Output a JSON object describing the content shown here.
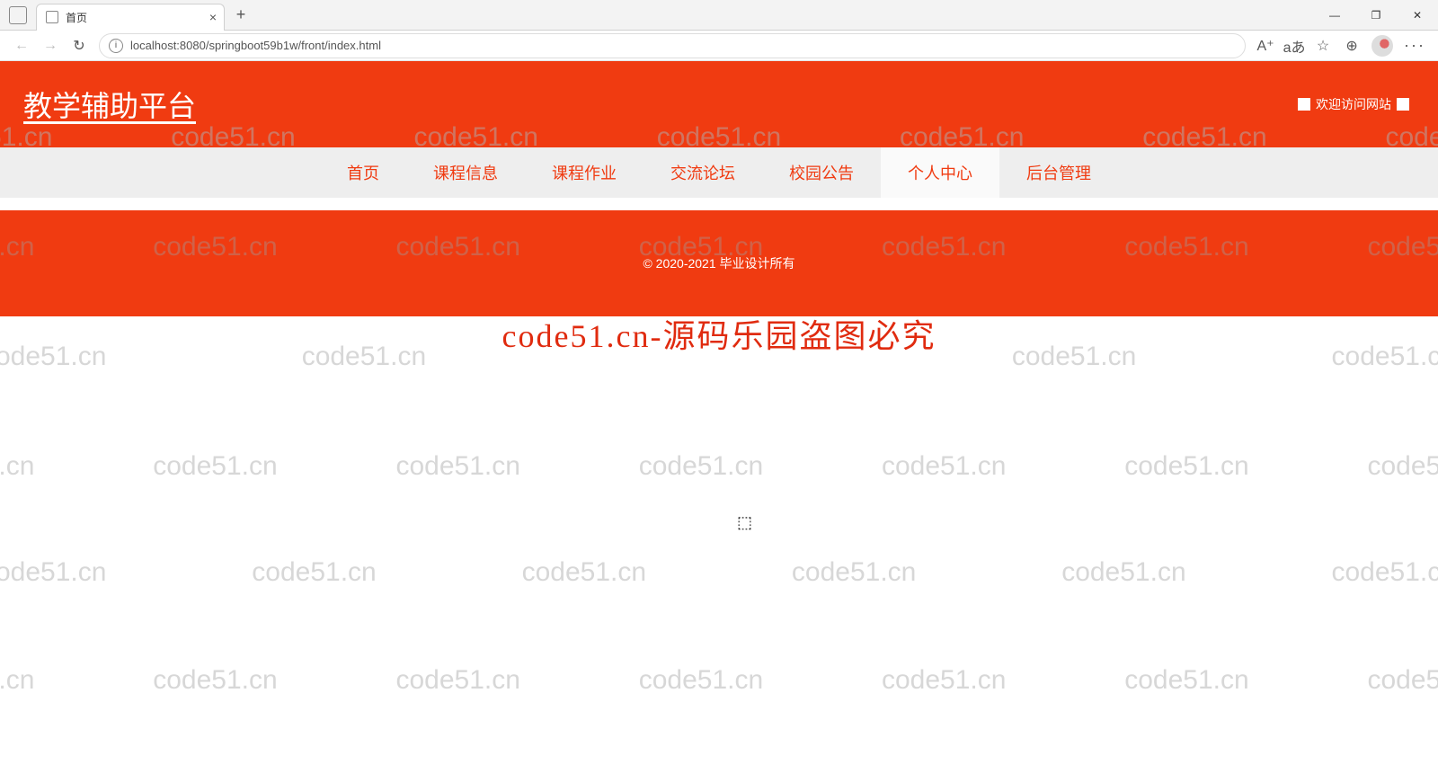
{
  "browser": {
    "tab_title": "首页",
    "url": "localhost:8080/springboot59b1w/front/index.html",
    "win_min": "—",
    "win_max": "❐",
    "win_close": "✕"
  },
  "header": {
    "title": "教学辅助平台",
    "welcome": "欢迎访问网站"
  },
  "nav": {
    "items": [
      {
        "label": "首页",
        "active": false
      },
      {
        "label": "课程信息",
        "active": false
      },
      {
        "label": "课程作业",
        "active": false
      },
      {
        "label": "交流论坛",
        "active": false
      },
      {
        "label": "校园公告",
        "active": false
      },
      {
        "label": "个人中心",
        "active": true
      },
      {
        "label": "后台管理",
        "active": false
      }
    ]
  },
  "footer": {
    "text": "© 2020-2021 毕业设计所有"
  },
  "overlay": {
    "text": "code51.cn-源码乐园盗图必究"
  },
  "watermark": {
    "text": "code51.cn"
  }
}
